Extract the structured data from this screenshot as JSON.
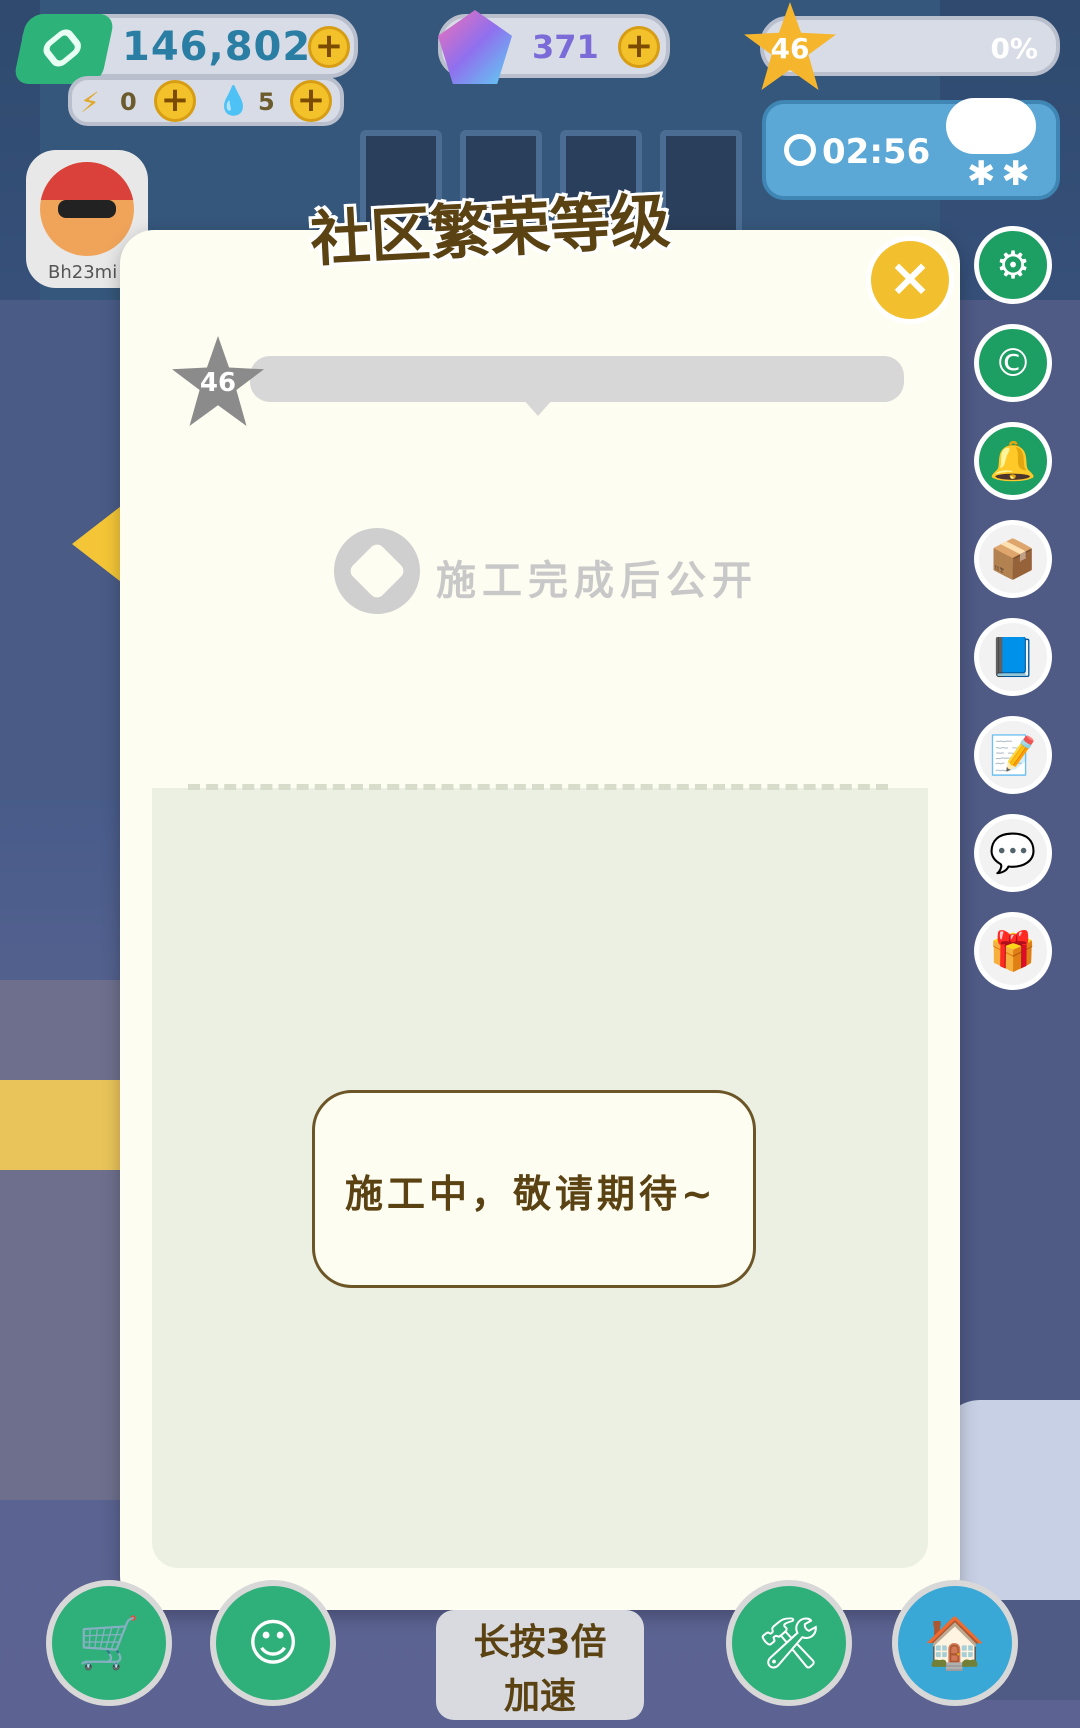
{
  "hud": {
    "money": "146,802",
    "energy": "0",
    "water": "5",
    "gems": "371",
    "level": "46",
    "level_progress_text": "0%",
    "level_progress": 0,
    "timer": "02:56"
  },
  "player": {
    "name": "Bh23mi"
  },
  "modal": {
    "title": "社区繁荣等级",
    "close_label": "×",
    "level": "46",
    "locked_text": "施工完成后公开",
    "notice_text": "施工中，敬请期待~"
  },
  "bottom": {
    "speed_label_line1": "长按3倍",
    "speed_label_line2": "加速"
  },
  "icons": {
    "settings": "gear-icon",
    "c": "c-icon",
    "bell": "bell-icon",
    "box": "mystery-box-icon",
    "book": "book-icon",
    "notes": "notes-icon",
    "chat": "chat-icon",
    "gift": "gift-icon",
    "cart": "cart-icon",
    "face": "smile-icon",
    "tools": "tools-icon",
    "house": "house-icon"
  },
  "colors": {
    "accent_green": "#1d9e63",
    "accent_yellow": "#f4c637",
    "modal_bg": "#fdfdf1",
    "title_brown": "#5a4213"
  }
}
